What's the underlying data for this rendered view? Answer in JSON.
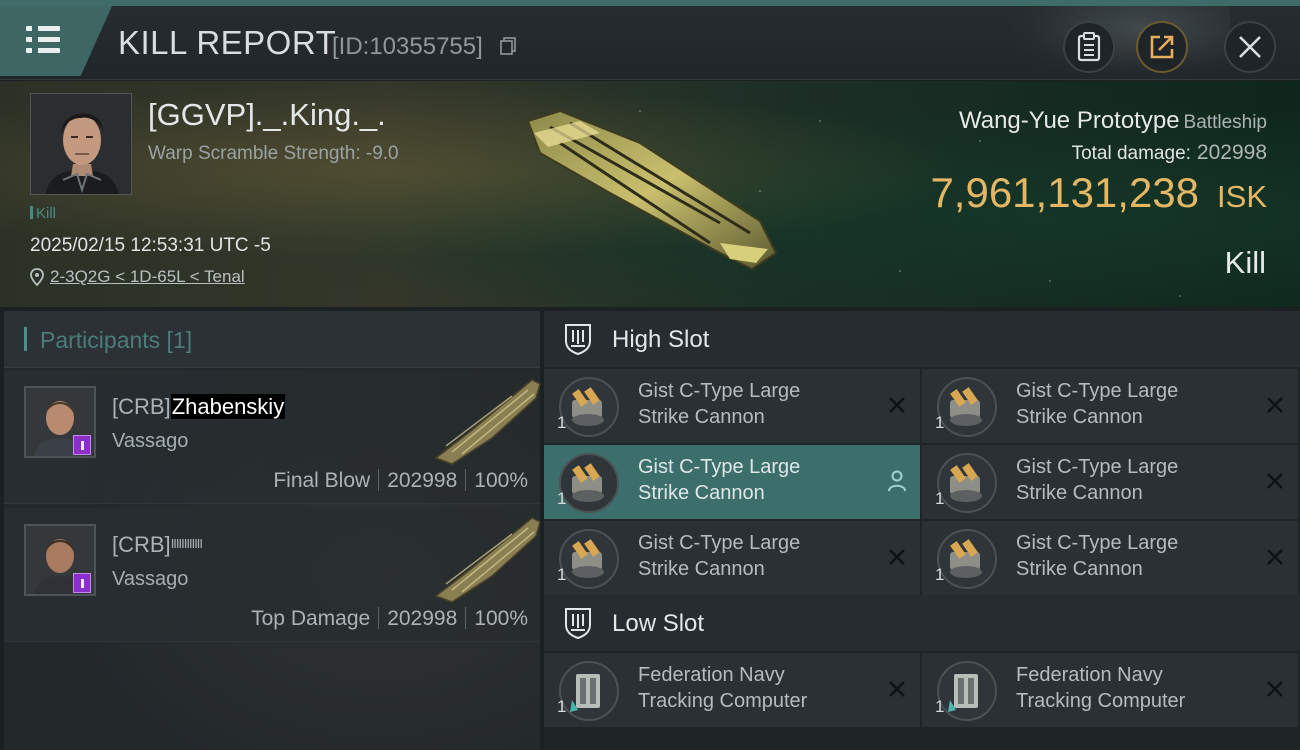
{
  "header": {
    "title": "KILL REPORT",
    "report_id": "[ID:10355755]",
    "icons": [
      "menu-icon",
      "copy-icon",
      "clipboard-icon",
      "share-icon",
      "close-icon"
    ]
  },
  "victim": {
    "name": "[GGVP]._.King._.",
    "warp_scramble": "Warp Scramble Strength: -9.0",
    "tag": "Kill",
    "datetime": "2025/02/15 12:53:31 UTC -5",
    "location": "2-3Q2G < 1D-65L < Tenal",
    "ship_name": "Wang-Yue Prototype",
    "ship_class": "Battleship",
    "total_damage_label": "Total damage:",
    "total_damage": "202998",
    "isk_value": "7,961,131,238",
    "isk_unit": "ISK",
    "result": "Kill"
  },
  "participants": {
    "title": "Participants [1]",
    "items": [
      {
        "prefix": "[CRB]",
        "name": "Zhabenskiy",
        "ship": "Vassago",
        "role": "Final Blow",
        "damage": "202998",
        "percent": "100%"
      },
      {
        "prefix": "[CRB]",
        "name": "IIIIIIIIIIII",
        "ship": "Vassago",
        "role": "Top Damage",
        "damage": "202998",
        "percent": "100%"
      }
    ]
  },
  "slots": {
    "high": {
      "title": "High Slot",
      "modules": [
        {
          "name_1": "Gist C-Type Large",
          "name_2": "Strike Cannon",
          "qty": "1",
          "state": "destroyed"
        },
        {
          "name_1": "Gist C-Type Large",
          "name_2": "Strike Cannon",
          "qty": "1",
          "state": "destroyed"
        },
        {
          "name_1": "Gist C-Type Large",
          "name_2": "Strike Cannon",
          "qty": "1",
          "state": "dropped"
        },
        {
          "name_1": "Gist C-Type Large",
          "name_2": "Strike Cannon",
          "qty": "1",
          "state": "destroyed"
        },
        {
          "name_1": "Gist C-Type Large",
          "name_2": "Strike Cannon",
          "qty": "1",
          "state": "destroyed"
        },
        {
          "name_1": "Gist C-Type Large",
          "name_2": "Strike Cannon",
          "qty": "1",
          "state": "destroyed"
        }
      ]
    },
    "low": {
      "title": "Low Slot",
      "modules": [
        {
          "name_1": "Federation Navy",
          "name_2": "Tracking Computer",
          "qty": "1",
          "state": "destroyed"
        },
        {
          "name_1": "Federation Navy",
          "name_2": "Tracking Computer",
          "qty": "1",
          "state": "destroyed"
        }
      ]
    }
  },
  "colors": {
    "accent_teal": "#3e6663",
    "isk_gold": "#e5b765",
    "badge_purple": "#8b2fc9",
    "active_row": "#3c6f6b"
  }
}
